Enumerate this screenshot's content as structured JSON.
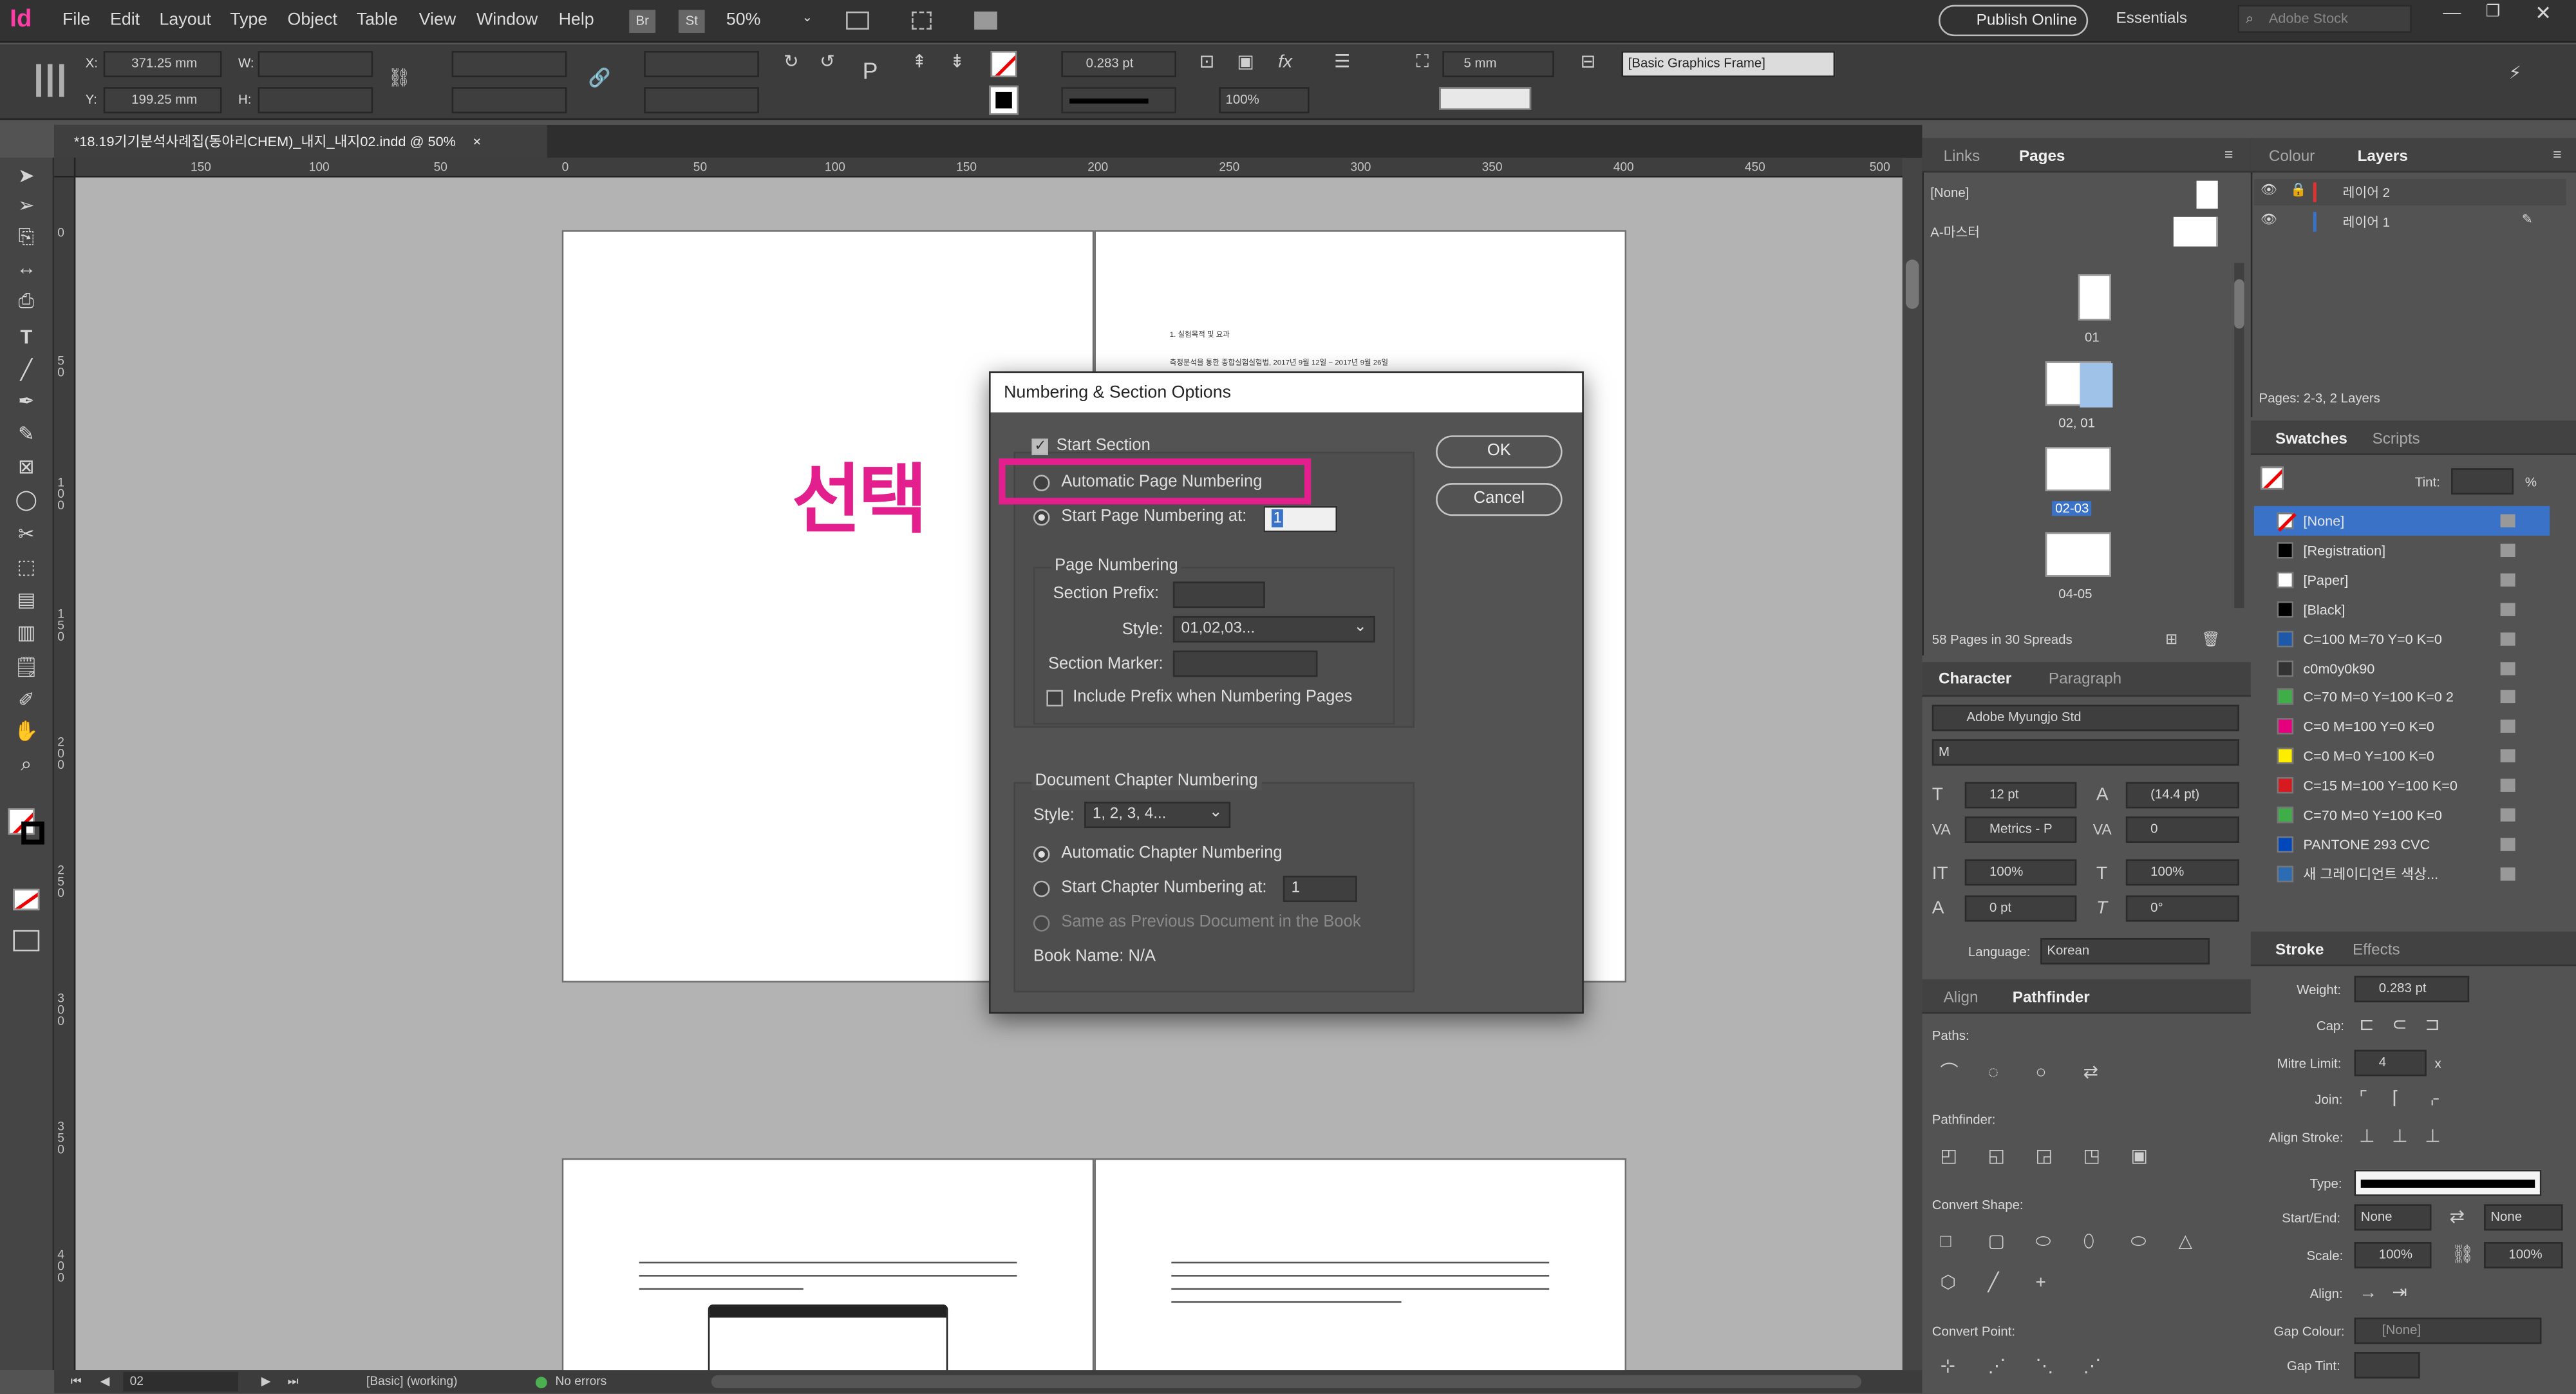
{
  "app": {
    "logo": "Id"
  },
  "menu": {
    "items": [
      "File",
      "Edit",
      "Layout",
      "Type",
      "Object",
      "Table",
      "View",
      "Window",
      "Help"
    ],
    "br": "Br",
    "st": "St",
    "zoom": "50%",
    "publish": "Publish Online",
    "workspace": "Essentials",
    "search_placeholder": "Adobe Stock"
  },
  "control": {
    "x": "371.25 mm",
    "y": "199.25 mm",
    "w_label": "W:",
    "h_label": "H:",
    "x_label": "X:",
    "y_label": "Y:",
    "stroke_weight": "0.283 pt",
    "opacity": "100%",
    "frame_style": "[Basic Graphics Frame]",
    "gap": "5 mm"
  },
  "document": {
    "tab_title": "*18.19기기분석사례집(동아리CHEM)_내지_내지02.indd @ 50%",
    "close": "×"
  },
  "ruler": {
    "h_ticks": [
      "150",
      "100",
      "50",
      "0",
      "50",
      "100",
      "150",
      "200",
      "250",
      "300",
      "350",
      "400",
      "450",
      "500"
    ],
    "v_ticks": [
      "0",
      "5\n0",
      "1\n0\n0",
      "1\n5\n0",
      "2\n0\n0",
      "2\n5\n0",
      "3\n0\n0",
      "3\n5\n0",
      "4\n0\n0"
    ]
  },
  "canvas": {
    "annotation": "선택",
    "page2_heading": "1. 실험목적 및 요과",
    "page2_line": "측정분석을 통한 종합실험실험법, 2017년 9월 12일 ~ 2017년 9월 26일"
  },
  "dialog": {
    "title": "Numbering & Section Options",
    "start_section": "Start Section",
    "auto_page": "Automatic Page Numbering",
    "start_page": "Start Page Numbering at:",
    "start_page_value": "1",
    "page_numbering": "Page Numbering",
    "section_prefix": "Section Prefix:",
    "style": "Style:",
    "style_value": "01,02,03...",
    "section_marker": "Section Marker:",
    "include_prefix": "Include Prefix when Numbering Pages",
    "doc_chapter": "Document Chapter Numbering",
    "chapter_style_value": "1, 2, 3, 4...",
    "auto_chapter": "Automatic Chapter Numbering",
    "start_chapter": "Start Chapter Numbering at:",
    "start_chapter_value": "1",
    "same_prev": "Same as Previous Document in the Book",
    "book_name": "Book Name: N/A",
    "ok": "OK",
    "cancel": "Cancel"
  },
  "pages_panel": {
    "tab_links": "Links",
    "tab_pages": "Pages",
    "none": "[None]",
    "master": "A-마스터",
    "labels": [
      "01",
      "02, 01",
      "02-03",
      "04-05"
    ],
    "footer": "58 Pages in 30 Spreads"
  },
  "layers_panel": {
    "tab_colour": "Colour",
    "tab_layers": "Layers",
    "layers": [
      "레이어 2",
      "레이어 1"
    ],
    "footer": "Pages: 2-3, 2 Layers"
  },
  "swatches": {
    "tab": "Swatches",
    "tab2": "Scripts",
    "tint_label": "Tint:",
    "tint_pct": "%",
    "items": [
      {
        "name": "[None]",
        "color": "#ffffff"
      },
      {
        "name": "[Registration]",
        "color": "#000000"
      },
      {
        "name": "[Paper]",
        "color": "#ffffff"
      },
      {
        "name": "[Black]",
        "color": "#000000"
      },
      {
        "name": "C=100 M=70 Y=0 K=0",
        "color": "#1e58a8"
      },
      {
        "name": "c0m0y0k90",
        "color": "#333333"
      },
      {
        "name": "C=70 M=0 Y=100 K=0 2",
        "color": "#3fae49"
      },
      {
        "name": "C=0 M=100 Y=0 K=0",
        "color": "#e6007e"
      },
      {
        "name": "C=0 M=0 Y=100 K=0",
        "color": "#ffed00"
      },
      {
        "name": "C=15 M=100 Y=100 K=0",
        "color": "#d71920"
      },
      {
        "name": "C=70 M=0 Y=100 K=0",
        "color": "#3fae49"
      },
      {
        "name": "PANTONE 293 CVC",
        "color": "#0047bb"
      },
      {
        "name": "새 그레이디언트 색상...",
        "color": "#2b6cb5"
      }
    ]
  },
  "character": {
    "tab": "Character",
    "tab2": "Paragraph",
    "font": "Adobe Myungjo Std",
    "style": "M",
    "size": "12 pt",
    "leading": "(14.4 pt)",
    "kerning": "Metrics - P",
    "tracking": "0",
    "vscale": "100%",
    "hscale": "100%",
    "baseline": "0 pt",
    "skew": "0°",
    "language_label": "Language:",
    "language": "Korean"
  },
  "pathfinder": {
    "tab": "Align",
    "tab2": "Pathfinder",
    "paths": "Paths:",
    "pathfinder": "Pathfinder:",
    "convert_shape": "Convert Shape:",
    "convert_point": "Convert Point:"
  },
  "stroke": {
    "tab": "Stroke",
    "tab2": "Effects",
    "weight_label": "Weight:",
    "weight": "0.283 pt",
    "cap": "Cap:",
    "mitre": "Mitre Limit:",
    "mitre_val": "4",
    "mitre_x": "x",
    "join": "Join:",
    "align": "Align Stroke:",
    "type": "Type:",
    "startend": "Start/End:",
    "start": "None",
    "end": "None",
    "scale": "Scale:",
    "scale1": "100%",
    "scale2": "100%",
    "align2": "Align:",
    "gapcolour": "Gap Colour:",
    "gap_val": "[None]",
    "gaptint": "Gap Tint:"
  },
  "status": {
    "page": "02",
    "style": "[Basic] (working)",
    "errors": "No errors"
  }
}
